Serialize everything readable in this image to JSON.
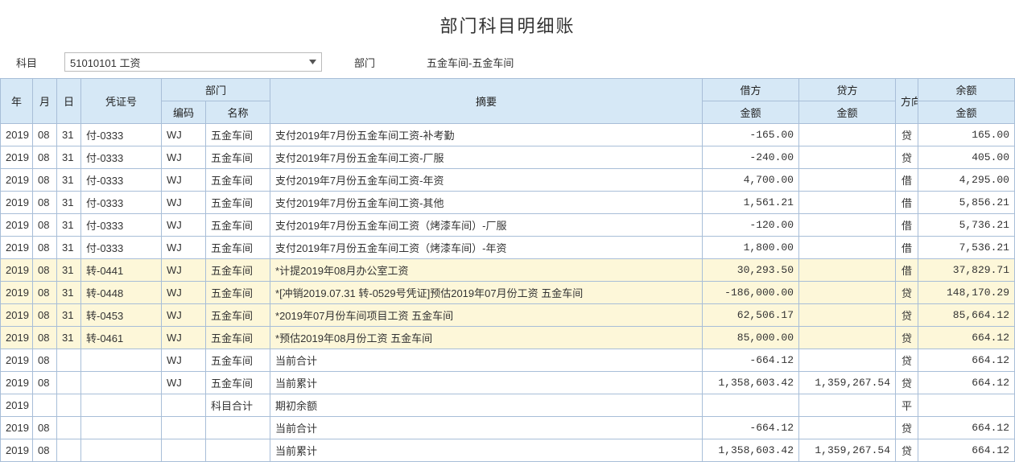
{
  "title": "部门科目明细账",
  "filters": {
    "subject_label": "科目",
    "subject_value": "51010101 工资",
    "dept_label": "部门",
    "dept_value": "五金车间-五金车间"
  },
  "headers": {
    "year": "年",
    "month": "月",
    "day": "日",
    "voucher": "凭证号",
    "dept": "部门",
    "dept_code": "编码",
    "dept_name": "名称",
    "summary": "摘要",
    "debit": "借方",
    "credit": "贷方",
    "amount": "金额",
    "direction": "方向",
    "balance": "余额"
  },
  "rows": [
    {
      "year": "2019",
      "month": "08",
      "day": "31",
      "voucher": "付-0333",
      "deptcode": "WJ",
      "deptname": "五金车间",
      "summary": "支付2019年7月份五金车间工资-补考勤",
      "debit": "-165.00",
      "credit": "",
      "dir": "贷",
      "balance": "165.00",
      "hl": false
    },
    {
      "year": "2019",
      "month": "08",
      "day": "31",
      "voucher": "付-0333",
      "deptcode": "WJ",
      "deptname": "五金车间",
      "summary": "支付2019年7月份五金车间工资-厂服",
      "debit": "-240.00",
      "credit": "",
      "dir": "贷",
      "balance": "405.00",
      "hl": false
    },
    {
      "year": "2019",
      "month": "08",
      "day": "31",
      "voucher": "付-0333",
      "deptcode": "WJ",
      "deptname": "五金车间",
      "summary": "支付2019年7月份五金车间工资-年资",
      "debit": "4,700.00",
      "credit": "",
      "dir": "借",
      "balance": "4,295.00",
      "hl": false
    },
    {
      "year": "2019",
      "month": "08",
      "day": "31",
      "voucher": "付-0333",
      "deptcode": "WJ",
      "deptname": "五金车间",
      "summary": "支付2019年7月份五金车间工资-其他",
      "debit": "1,561.21",
      "credit": "",
      "dir": "借",
      "balance": "5,856.21",
      "hl": false
    },
    {
      "year": "2019",
      "month": "08",
      "day": "31",
      "voucher": "付-0333",
      "deptcode": "WJ",
      "deptname": "五金车间",
      "summary": "支付2019年7月份五金车间工资（烤漆车间）-厂服",
      "debit": "-120.00",
      "credit": "",
      "dir": "借",
      "balance": "5,736.21",
      "hl": false
    },
    {
      "year": "2019",
      "month": "08",
      "day": "31",
      "voucher": "付-0333",
      "deptcode": "WJ",
      "deptname": "五金车间",
      "summary": "支付2019年7月份五金车间工资（烤漆车间）-年资",
      "debit": "1,800.00",
      "credit": "",
      "dir": "借",
      "balance": "7,536.21",
      "hl": false
    },
    {
      "year": "2019",
      "month": "08",
      "day": "31",
      "voucher": "转-0441",
      "deptcode": "WJ",
      "deptname": "五金车间",
      "summary": "*计提2019年08月办公室工资",
      "debit": "30,293.50",
      "credit": "",
      "dir": "借",
      "balance": "37,829.71",
      "hl": true
    },
    {
      "year": "2019",
      "month": "08",
      "day": "31",
      "voucher": "转-0448",
      "deptcode": "WJ",
      "deptname": "五金车间",
      "summary": "*[冲销2019.07.31  转-0529号凭证]预估2019年07月份工资  五金车间",
      "debit": "-186,000.00",
      "credit": "",
      "dir": "贷",
      "balance": "148,170.29",
      "hl": true
    },
    {
      "year": "2019",
      "month": "08",
      "day": "31",
      "voucher": "转-0453",
      "deptcode": "WJ",
      "deptname": "五金车间",
      "summary": "*2019年07月份车间项目工资   五金车间",
      "debit": "62,506.17",
      "credit": "",
      "dir": "贷",
      "balance": "85,664.12",
      "hl": true
    },
    {
      "year": "2019",
      "month": "08",
      "day": "31",
      "voucher": "转-0461",
      "deptcode": "WJ",
      "deptname": "五金车间",
      "summary": "*预估2019年08月份工资  五金车间",
      "debit": "85,000.00",
      "credit": "",
      "dir": "贷",
      "balance": "664.12",
      "hl": true
    },
    {
      "year": "2019",
      "month": "08",
      "day": "",
      "voucher": "",
      "deptcode": "WJ",
      "deptname": "五金车间",
      "summary": "当前合计",
      "debit": "-664.12",
      "credit": "",
      "dir": "贷",
      "balance": "664.12",
      "hl": false
    },
    {
      "year": "2019",
      "month": "08",
      "day": "",
      "voucher": "",
      "deptcode": "WJ",
      "deptname": "五金车间",
      "summary": "当前累计",
      "debit": "1,358,603.42",
      "credit": "1,359,267.54",
      "dir": "贷",
      "balance": "664.12",
      "hl": false
    },
    {
      "year": "2019",
      "month": "",
      "day": "",
      "voucher": "",
      "deptcode": "",
      "deptname": "科目合计",
      "summary": "期初余额",
      "debit": "",
      "credit": "",
      "dir": "平",
      "balance": "",
      "hl": false
    },
    {
      "year": "2019",
      "month": "08",
      "day": "",
      "voucher": "",
      "deptcode": "",
      "deptname": "",
      "summary": "当前合计",
      "debit": "-664.12",
      "credit": "",
      "dir": "贷",
      "balance": "664.12",
      "hl": false
    },
    {
      "year": "2019",
      "month": "08",
      "day": "",
      "voucher": "",
      "deptcode": "",
      "deptname": "",
      "summary": "当前累计",
      "debit": "1,358,603.42",
      "credit": "1,359,267.54",
      "dir": "贷",
      "balance": "664.12",
      "hl": false
    }
  ]
}
